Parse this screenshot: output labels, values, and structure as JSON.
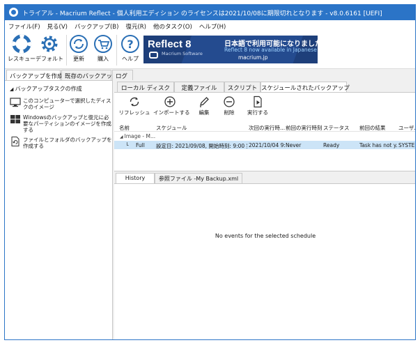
{
  "window": {
    "title": "トライアル - Macrium Reflect - 個人利用エディション のライセンスは2021/10/08に期限切れとなります - v8.0.6161  [UEFI]",
    "minimize": "—",
    "maximize": "☐",
    "close": "✕"
  },
  "menu": [
    "ファイル(F)",
    "見る(V)",
    "バックアップ(B)",
    "復元(R)",
    "他のタスク(O)",
    "ヘルプ(H)"
  ],
  "toolbar": {
    "rescue": "レスキュー",
    "default": "デフォルト",
    "update": "更新",
    "buy": "購入",
    "help": "ヘルプ"
  },
  "banner": {
    "brand": "Reflect 8",
    "sub": "Macrium Software",
    "line1": "日本語で利用可能になりました",
    "line2": "Reflect 8 now available in Japanese",
    "line3": "macrium.jp"
  },
  "left_tabs": [
    "バックアップを作成する",
    "既存のバックアップ",
    "ログ"
  ],
  "left_panel": {
    "heading": "バックアップタスクの作成",
    "items": [
      "このコンピューターで選択したディスクのイメージ",
      "Windowsのバックアップと復元に必要なパーティションのイメージを作成する",
      "ファイルとフォルダのバックアップを作成する"
    ]
  },
  "right_tabs": [
    "ローカル ディスク",
    "定義ファイル",
    "スクリプト",
    "スケジュールされたバックアップ"
  ],
  "right_toolbar": {
    "refresh": "リフレッシュ",
    "import": "インポートする",
    "edit": "編集",
    "delete": "削除",
    "run": "実行する"
  },
  "grid": {
    "columns": [
      "名前",
      "スケジュール",
      "次回の実行時...",
      "前回の実行時刻",
      "ステータス",
      "前回の結果",
      "ユーザ..."
    ],
    "group": "Image - M...",
    "rows": [
      [
        "└",
        "Full",
        "設定日: 2021/09/08, 開始時刻: 9:00  実...",
        "2021/10/04 9:...",
        "Never",
        "Ready",
        "Task has not y...",
        "SYSTE..."
      ]
    ]
  },
  "bottom_tabs": [
    "History",
    "参照ファイル -My Backup.xml"
  ],
  "history_message": "No events for the selected schedule",
  "colors": {
    "title_bar": "#2b74c7",
    "selection": "#cce4f7",
    "banner": "#1e3f7a"
  }
}
